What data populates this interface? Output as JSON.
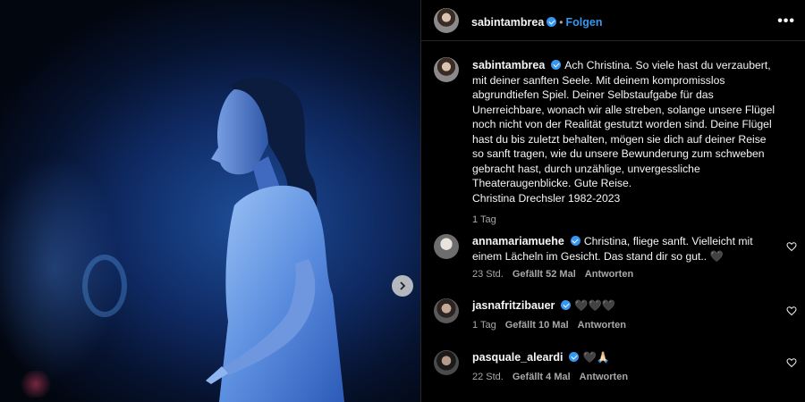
{
  "post": {
    "author": "sabintambrea",
    "follow_label": "Folgen",
    "more_label": "•••",
    "separator": "•"
  },
  "caption": {
    "author": "sabintambrea",
    "text": "Ach Christina. So viele hast du verzaubert, mit deiner sanften Seele. Mit deinem kompromisslos abgrundtiefen Spiel. Deiner Selbstaufgabe für das Unerreichbare, wonach wir alle streben, solange unsere Flügel noch nicht von der Realität gestutzt worden sind. Deine Flügel hast du bis zuletzt behalten, mögen sie dich auf deiner Reise so sanft tragen, wie du unsere Bewunderung zum schweben gebracht hast, durch unzählige, unvergessliche Theateraugenblicke. Gute Reise.",
    "signature": "Christina Drechsler 1982-2023",
    "time": "1 Tag"
  },
  "comments": [
    {
      "user": "annamariamuehe",
      "text": "Christina, fliege sanft. Vielleicht mit einem Lächeln im Gesicht. Das stand dir so gut.. 🖤",
      "time": "23 Std.",
      "likes": "Gefällt 52 Mal",
      "reply": "Antworten"
    },
    {
      "user": "jasnafritzibauer",
      "text": "🖤🖤🖤",
      "time": "1 Tag",
      "likes": "Gefällt 10 Mal",
      "reply": "Antworten"
    },
    {
      "user": "pasquale_aleardi",
      "text": "🖤🙏🏻",
      "time": "22 Std.",
      "likes": "Gefällt 4 Mal",
      "reply": "Antworten"
    }
  ],
  "colors": {
    "accent": "#3797f0",
    "background": "#000000",
    "secondary_text": "#a8a8a8"
  },
  "icons": [
    "verified-badge-icon",
    "heart-icon",
    "chevron-right-icon",
    "more-icon"
  ]
}
